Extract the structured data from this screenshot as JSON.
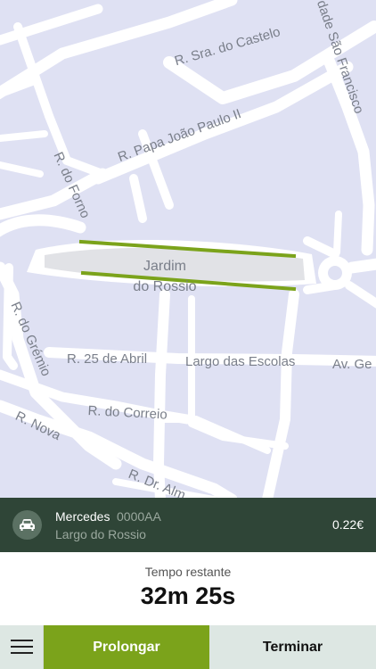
{
  "map": {
    "streets": [
      "R. Sra. do Castelo",
      "R. Papa João Paulo II",
      "R. do Forno",
      "R. do Grémio",
      "R. 25 de Abril",
      "Largo das Escolas",
      "Av. Ge",
      "R. do Correio",
      "R. Nova",
      "R. Dr. Alm",
      "dade São Francisco"
    ],
    "poi": {
      "line1": "Jardim",
      "line2": "do Rossio"
    },
    "colors": {
      "background": "#dfe1f3",
      "road": "#ffffff",
      "park": "#e1e2e6",
      "zone": "#7ba31b"
    }
  },
  "rental": {
    "icon": "car-icon",
    "vehicle": "Mercedes",
    "plate": "0000AA",
    "location": "Largo do Rossio",
    "price": "0.22€"
  },
  "timer": {
    "caption": "Tempo restante",
    "value": "32m 25s"
  },
  "actions": {
    "menu_icon": "hamburger-menu-icon",
    "extend_label": "Prolongar",
    "finish_label": "Terminar"
  },
  "colors": {
    "info_bar": "#2f4537",
    "extend_button": "#7ba31b",
    "finish_button": "#dde7e3"
  }
}
